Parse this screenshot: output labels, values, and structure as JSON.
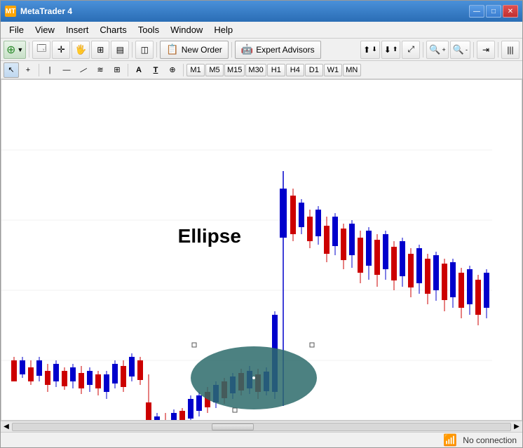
{
  "window": {
    "title": "MetaTrader 4",
    "icon": "MT"
  },
  "title_bar": {
    "text": "MetaTrader 4",
    "min_label": "—",
    "max_label": "□",
    "close_label": "✕"
  },
  "menu": {
    "items": [
      "File",
      "View",
      "Insert",
      "Charts",
      "Tools",
      "Window",
      "Help"
    ]
  },
  "toolbar1": {
    "buttons": [
      {
        "label": "⊕",
        "name": "new-chart"
      },
      {
        "label": "↩",
        "name": "undo"
      },
      {
        "label": "✦",
        "name": "crosshair"
      },
      {
        "label": "↔",
        "name": "move"
      },
      {
        "label": "⤡",
        "name": "zoom-select"
      },
      {
        "label": "▤",
        "name": "properties"
      },
      {
        "label": "◫",
        "name": "templates"
      },
      {
        "label": "◈",
        "name": "profiles"
      }
    ],
    "new_order_label": "New Order",
    "expert_advisors_label": "Expert Advisors"
  },
  "toolbar2": {
    "tools": [
      {
        "label": "↖",
        "name": "cursor-tool",
        "active": true
      },
      {
        "label": "+",
        "name": "crosshair-tool"
      },
      {
        "label": "|",
        "name": "vertical-line"
      },
      {
        "label": "—",
        "name": "horizontal-line"
      },
      {
        "label": "↗",
        "name": "trend-line"
      },
      {
        "label": "≋",
        "name": "channel"
      },
      {
        "label": "⊞",
        "name": "grid"
      },
      {
        "label": "A",
        "name": "text-tool"
      },
      {
        "label": "T",
        "name": "text-label"
      },
      {
        "label": "⊕",
        "name": "fibonacci"
      }
    ],
    "timeframes": [
      "M1",
      "M5",
      "M15",
      "M30",
      "H1",
      "H4",
      "D1",
      "W1",
      "MN"
    ]
  },
  "chart": {
    "ellipse_label": "Ellipse",
    "ellipse_color": "#2d6b6b",
    "ellipse_opacity": 0.85
  },
  "status_bar": {
    "connection_label": "No connection"
  },
  "candles": {
    "bullish_color": "#0000cc",
    "bearish_color": "#cc0000"
  }
}
